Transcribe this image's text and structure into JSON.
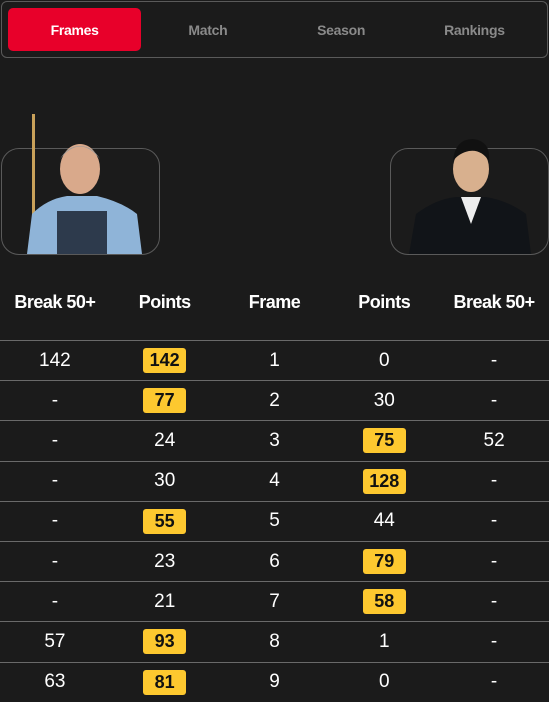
{
  "tabs": [
    {
      "label": "Frames",
      "active": true
    },
    {
      "label": "Match"
    },
    {
      "label": "Season"
    },
    {
      "label": "Rankings"
    }
  ],
  "colors": {
    "accent": "#e8002a",
    "highlight": "#fdc82f"
  },
  "headers": [
    "Break 50+",
    "Points",
    "Frame",
    "Points",
    "Break 50+"
  ],
  "rows": [
    {
      "b1": "142",
      "p1": "142",
      "f": "1",
      "p2": "0",
      "b2": "-",
      "win": 1
    },
    {
      "b1": "-",
      "p1": "77",
      "f": "2",
      "p2": "30",
      "b2": "-",
      "win": 1
    },
    {
      "b1": "-",
      "p1": "24",
      "f": "3",
      "p2": "75",
      "b2": "52",
      "win": 2
    },
    {
      "b1": "-",
      "p1": "30",
      "f": "4",
      "p2": "128",
      "b2": "-",
      "win": 2
    },
    {
      "b1": "-",
      "p1": "55",
      "f": "5",
      "p2": "44",
      "b2": "-",
      "win": 1
    },
    {
      "b1": "-",
      "p1": "23",
      "f": "6",
      "p2": "79",
      "b2": "-",
      "win": 2
    },
    {
      "b1": "-",
      "p1": "21",
      "f": "7",
      "p2": "58",
      "b2": "-",
      "win": 2
    },
    {
      "b1": "57",
      "p1": "93",
      "f": "8",
      "p2": "1",
      "b2": "-",
      "win": 1
    },
    {
      "b1": "63",
      "p1": "81",
      "f": "9",
      "p2": "0",
      "b2": "-",
      "win": 1
    }
  ]
}
